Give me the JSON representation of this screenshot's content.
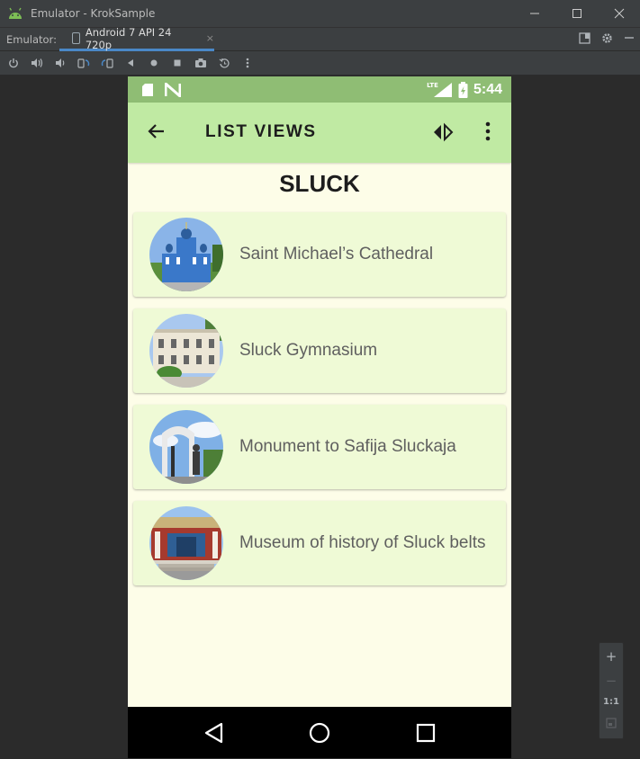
{
  "window": {
    "title": "Emulator - KrokSample",
    "controls": [
      "minimize",
      "maximize",
      "close"
    ]
  },
  "tabbar": {
    "label": "Emulator:",
    "tab_label": "Android 7 API 24 720p",
    "close_symbol": "×"
  },
  "toolbar": {
    "icons": [
      "power-icon",
      "volume-up-icon",
      "volume-down-icon",
      "rotate-left-icon",
      "rotate-right-icon",
      "back-icon",
      "home-icon",
      "overview-icon",
      "camera-icon",
      "replay-icon",
      "more-icon"
    ]
  },
  "device": {
    "status_bar": {
      "time": "5:44",
      "network": "LTE"
    },
    "app_bar": {
      "title": "LIST VIEWS"
    },
    "heading": "SLUCK",
    "items": [
      {
        "name": "Saint Michael’s Cathedral"
      },
      {
        "name": "Sluck Gymnasium"
      },
      {
        "name": "Monument to Safija Sluckaja"
      },
      {
        "name": "Museum of history of Sluck belts"
      }
    ]
  },
  "zoom_controls": {
    "zoom_in": "+",
    "zoom_out": "−",
    "actual_size": "1:1"
  },
  "colors": {
    "ide_background": "#2b2b2b",
    "ide_panel": "#3c3f41",
    "status_bar": "#8fbd74",
    "app_bar": "#c0eaa3",
    "screen_background": "#fdfde8",
    "card_background": "#effad6",
    "tab_accent": "#4a88c7"
  }
}
